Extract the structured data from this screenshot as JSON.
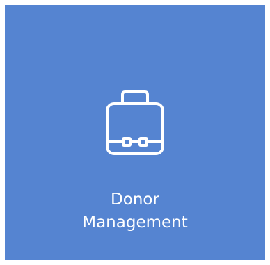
{
  "tile": {
    "label_line1": "Donor",
    "label_line2": "Management",
    "icon": "briefcase-icon",
    "background_color": "#5584d1",
    "text_color": "#ffffff"
  }
}
